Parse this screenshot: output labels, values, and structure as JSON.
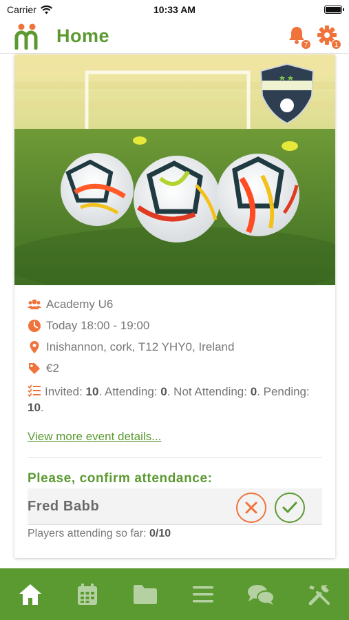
{
  "status_bar": {
    "carrier": "Carrier",
    "time": "10:33 AM"
  },
  "header": {
    "title": "Home",
    "notifications_count": "7",
    "settings_count": "1"
  },
  "event": {
    "team": "Academy U6",
    "time": "Today 18:00 - 19:00",
    "location": "Inishannon, cork, T12 YHY0, Ireland",
    "price": "€2",
    "invited_label": "Invited: ",
    "invited": "10",
    "attending_label": ". Attending: ",
    "attending": "0",
    "not_attending_label": ". Not Attending: ",
    "not_attending": "0",
    "pending_label": ". Pending: ",
    "pending": "10",
    "stats_end": ".",
    "details_link": "View more event details..."
  },
  "attendance": {
    "title": "Please, confirm attendance:",
    "player_name": "Fred Babb",
    "summary_label": "Players attending so far: ",
    "summary_value": "0/10"
  },
  "icons": {
    "bell": "bell-icon",
    "gear": "gear-icon",
    "group": "group-icon",
    "clock": "clock-icon",
    "pin": "location-pin-icon",
    "tag": "price-tag-icon",
    "checklist": "checklist-icon"
  },
  "tabs": [
    "home-icon",
    "calendar-icon",
    "folder-icon",
    "menu-icon",
    "chat-icon",
    "tools-icon"
  ],
  "colors": {
    "brand_green": "#5b9a31",
    "accent_orange": "#f0733b",
    "text_gray": "#777777"
  }
}
